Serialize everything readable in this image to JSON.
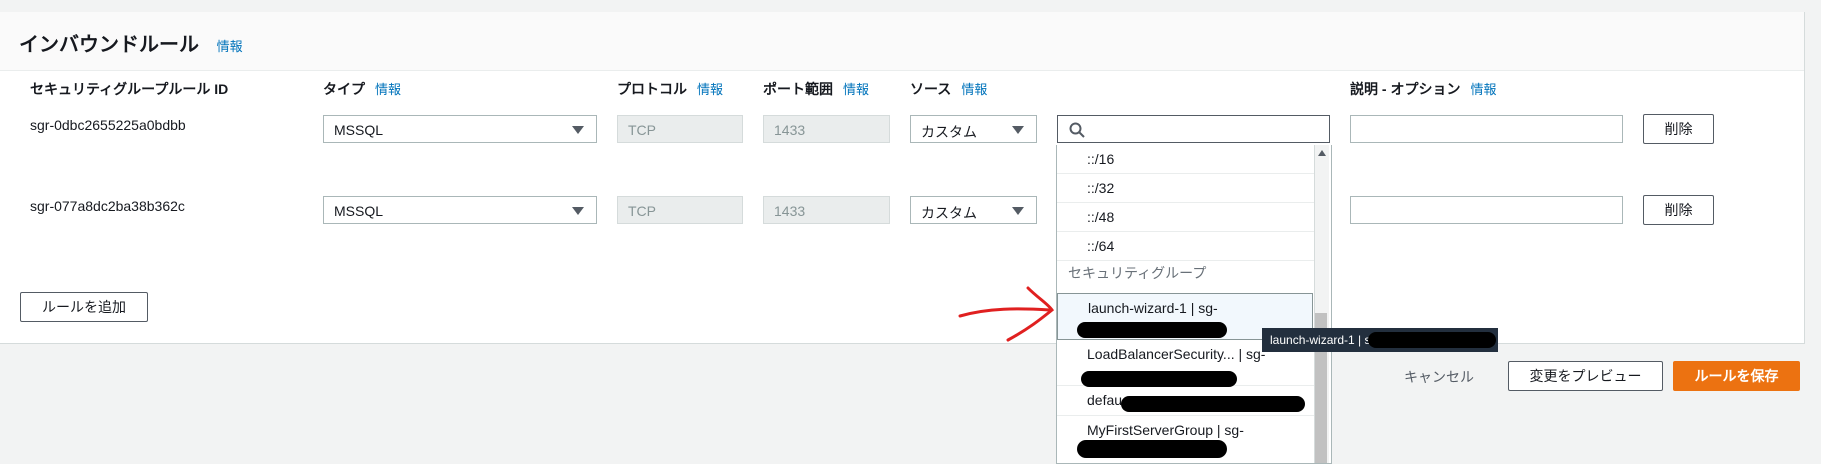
{
  "section": {
    "title": "インバウンドルール",
    "info": "情報"
  },
  "columns": {
    "rule_id": "セキュリティグループルール ID",
    "type": "タイプ",
    "type_info": "情報",
    "protocol": "プロトコル",
    "protocol_info": "情報",
    "port_range": "ポート範囲",
    "port_range_info": "情報",
    "source": "ソース",
    "source_info": "情報",
    "description": "説明 - オプション",
    "description_info": "情報"
  },
  "rules": [
    {
      "id": "sgr-0dbc2655225a0bdbb",
      "type": "MSSQL",
      "protocol": "TCP",
      "port": "1433",
      "source": "カスタム",
      "delete": "削除"
    },
    {
      "id": "sgr-077a8dc2ba38b362c",
      "type": "MSSQL",
      "protocol": "TCP",
      "port": "1433",
      "source": "カスタム",
      "delete": "削除"
    }
  ],
  "add_rule": "ルールを追加",
  "dropdown": {
    "cidr_options": [
      "::/16",
      "::/32",
      "::/48",
      "::/64"
    ],
    "group_label": "セキュリティグループ",
    "sg_options": [
      "launch-wizard-1 | sg-",
      "LoadBalancerSecurity... | sg-",
      "defau",
      "MyFirstServerGroup | sg-"
    ]
  },
  "tooltip": "launch-wizard-1 | sg",
  "footer": {
    "cancel": "キャンセル",
    "preview": "変更をプレビュー",
    "save": "ルールを保存"
  },
  "colors": {
    "primary": "#ec7211",
    "info_link": "#0073bb",
    "annotation_arrow": "#e02020"
  },
  "icons": [
    "search-icon",
    "caret-down-icon",
    "scroll-up-icon",
    "annotation-arrow-icon"
  ]
}
